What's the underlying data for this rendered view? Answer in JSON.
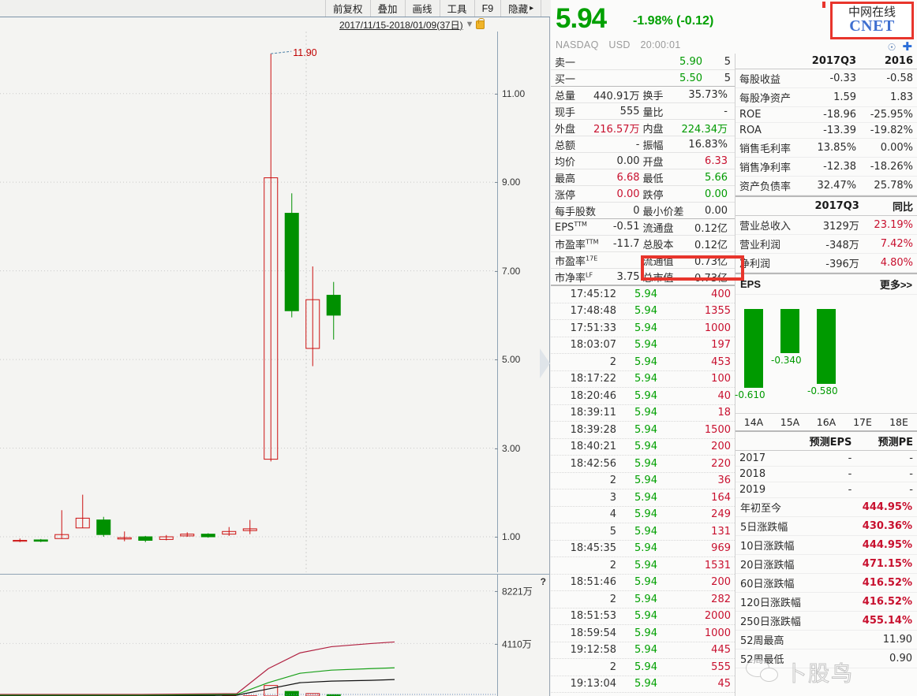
{
  "toolbar": {
    "buttons": [
      "前复权",
      "叠加",
      "画线",
      "工具",
      "F9",
      "隐藏"
    ],
    "date_range": "2017/11/15-2018/01/09(37日)"
  },
  "quote": {
    "last_price": "5.94",
    "change": "-1.98% (-0.12)",
    "exchange": "NASDAQ",
    "currency": "USD",
    "time": "20:00:01",
    "logo_cn": "中网在线",
    "logo_en": "CNET"
  },
  "level1": [
    {
      "k": "卖一",
      "v": "5.90",
      "v2": "5",
      "vclass": "green"
    },
    {
      "k": "买一",
      "v": "5.50",
      "v2": "5",
      "vclass": "green"
    }
  ],
  "stats": [
    [
      {
        "k": "总量",
        "v": "440.91万",
        "c": "dark"
      },
      {
        "k": "换手",
        "v": "35.73%",
        "c": "dark"
      }
    ],
    [
      {
        "k": "现手",
        "v": "555",
        "c": "dark"
      },
      {
        "k": "量比",
        "v": "-",
        "c": "dark"
      }
    ],
    [
      {
        "k": "外盘",
        "v": "216.57万",
        "c": "red"
      },
      {
        "k": "内盘",
        "v": "224.34万",
        "c": "green"
      }
    ],
    [
      {
        "k": "总额",
        "v": "-",
        "c": "dark"
      },
      {
        "k": "振幅",
        "v": "16.83%",
        "c": "dark"
      }
    ],
    [
      {
        "k": "均价",
        "v": "0.00",
        "c": "dark"
      },
      {
        "k": "开盘",
        "v": "6.33",
        "c": "red"
      }
    ],
    [
      {
        "k": "最高",
        "v": "6.68",
        "c": "red"
      },
      {
        "k": "最低",
        "v": "5.66",
        "c": "green"
      }
    ],
    [
      {
        "k": "涨停",
        "v": "0.00",
        "c": "red"
      },
      {
        "k": "跌停",
        "v": "0.00",
        "c": "green"
      }
    ],
    [
      {
        "k": "每手股数",
        "v": "0",
        "c": "dark"
      },
      {
        "k": "最小价差",
        "v": "0.00",
        "c": "dark"
      }
    ]
  ],
  "valuation": [
    [
      {
        "k": "EPS",
        "sup": "TTM",
        "v": "-0.51"
      },
      {
        "k": "流通盘",
        "sup": "",
        "v": "0.12亿"
      }
    ],
    [
      {
        "k": "市盈率",
        "sup": "TTM",
        "v": "-11.7"
      },
      {
        "k": "总股本",
        "sup": "",
        "v": "0.12亿"
      }
    ],
    [
      {
        "k": "市盈率",
        "sup": "17E",
        "v": ""
      },
      {
        "k": "流通值",
        "sup": "",
        "v": "0.73亿"
      }
    ],
    [
      {
        "k": "市净率",
        "sup": "LF",
        "v": "3.75"
      },
      {
        "k": "总市值",
        "sup": "",
        "v": "0.73亿"
      }
    ]
  ],
  "trades": [
    {
      "t": "17:45:12",
      "p": "5.94",
      "q": "400"
    },
    {
      "t": "17:48:48",
      "p": "5.94",
      "q": "1355"
    },
    {
      "t": "17:51:33",
      "p": "5.94",
      "q": "1000"
    },
    {
      "t": "18:03:07",
      "p": "5.94",
      "q": "197"
    },
    {
      "t": "2",
      "p": "5.94",
      "q": "453"
    },
    {
      "t": "18:17:22",
      "p": "5.94",
      "q": "100"
    },
    {
      "t": "18:20:46",
      "p": "5.94",
      "q": "40"
    },
    {
      "t": "18:39:11",
      "p": "5.94",
      "q": "18"
    },
    {
      "t": "18:39:28",
      "p": "5.94",
      "q": "1500"
    },
    {
      "t": "18:40:21",
      "p": "5.94",
      "q": "200"
    },
    {
      "t": "18:42:56",
      "p": "5.94",
      "q": "220"
    },
    {
      "t": "2",
      "p": "5.94",
      "q": "36"
    },
    {
      "t": "3",
      "p": "5.94",
      "q": "164"
    },
    {
      "t": "4",
      "p": "5.94",
      "q": "249"
    },
    {
      "t": "5",
      "p": "5.94",
      "q": "131"
    },
    {
      "t": "18:45:35",
      "p": "5.94",
      "q": "969"
    },
    {
      "t": "2",
      "p": "5.94",
      "q": "1531"
    },
    {
      "t": "18:51:46",
      "p": "5.94",
      "q": "200"
    },
    {
      "t": "2",
      "p": "5.94",
      "q": "282"
    },
    {
      "t": "18:51:53",
      "p": "5.94",
      "q": "2000"
    },
    {
      "t": "18:59:54",
      "p": "5.94",
      "q": "1000"
    },
    {
      "t": "19:12:58",
      "p": "5.94",
      "q": "445"
    },
    {
      "t": "2",
      "p": "5.94",
      "q": "555"
    },
    {
      "t": "19:13:04",
      "p": "5.94",
      "q": "45"
    }
  ],
  "fin_ratios": {
    "headers": [
      "",
      "2017Q3",
      "2016"
    ],
    "rows": [
      {
        "label": "每股收益",
        "c1": "-0.33",
        "c2": "-0.58"
      },
      {
        "label": "每股净资产",
        "c1": "1.59",
        "c2": "1.83"
      },
      {
        "label": "ROE",
        "c1": "-18.96",
        "c2": "-25.95%"
      },
      {
        "label": "ROA",
        "c1": "-13.39",
        "c2": "-19.82%"
      },
      {
        "label": "销售毛利率",
        "c1": "13.85%",
        "c2": "0.00%"
      },
      {
        "label": "销售净利率",
        "c1": "-12.38",
        "c2": "-18.26%"
      },
      {
        "label": "资产负债率",
        "c1": "32.47%",
        "c2": "25.78%"
      }
    ]
  },
  "fin_income": {
    "headers": [
      "",
      "2017Q3",
      "同比"
    ],
    "rows": [
      {
        "label": "营业总收入",
        "c1": "3129万",
        "c2": "23.19%"
      },
      {
        "label": "营业利润",
        "c1": "-348万",
        "c2": "7.42%"
      },
      {
        "label": "净利润",
        "c1": "-396万",
        "c2": "4.80%"
      }
    ]
  },
  "eps_section": {
    "title": "EPS",
    "more": "更多>>"
  },
  "forecast": {
    "headers": [
      "",
      "预测EPS",
      "预测PE"
    ],
    "rows": [
      {
        "year": "2017",
        "eps": "-",
        "pe": "-"
      },
      {
        "year": "2018",
        "eps": "-",
        "pe": "-"
      },
      {
        "year": "2019",
        "eps": "-",
        "pe": "-"
      }
    ]
  },
  "performance": [
    {
      "k": "年初至今",
      "v": "444.95%",
      "plain": false
    },
    {
      "k": "5日涨跌幅",
      "v": "430.36%",
      "plain": false
    },
    {
      "k": "10日涨跌幅",
      "v": "444.95%",
      "plain": false
    },
    {
      "k": "20日涨跌幅",
      "v": "471.15%",
      "plain": false
    },
    {
      "k": "60日涨跌幅",
      "v": "416.52%",
      "plain": false
    },
    {
      "k": "120日涨跌幅",
      "v": "416.52%",
      "plain": false
    },
    {
      "k": "250日涨跌幅",
      "v": "455.14%",
      "plain": false
    },
    {
      "k": "52周最高",
      "v": "11.90",
      "plain": true
    },
    {
      "k": "52周最低",
      "v": "0.90",
      "plain": true
    }
  ],
  "watermark": "卜股鸟",
  "chart_data": {
    "type": "candlestick",
    "title": "",
    "date_range": "2017/11/15-2018/01/09(37日)",
    "price_axis": {
      "ticks": [
        "11.00",
        "9.00",
        "7.00",
        "5.00",
        "3.00",
        "1.00"
      ],
      "values": [
        11,
        9,
        7,
        5,
        3,
        1
      ],
      "ylim": [
        0.2,
        12.4
      ]
    },
    "annotations": [
      {
        "text": "11.90",
        "value": 11.9,
        "color": "#c00000"
      }
    ],
    "volume_axis": {
      "ticks": [
        "8221万",
        "4110万"
      ],
      "values": [
        82210000,
        41100000
      ],
      "ylim": [
        0,
        9500000
      ]
    },
    "candles": [
      {
        "o": 0.92,
        "h": 0.96,
        "l": 0.88,
        "c": 0.9,
        "up": false,
        "vol": 60000
      },
      {
        "o": 0.9,
        "h": 0.95,
        "l": 0.88,
        "c": 0.93,
        "up": true,
        "vol": 70000
      },
      {
        "o": 1.05,
        "h": 1.6,
        "l": 0.96,
        "c": 0.96,
        "up": false,
        "vol": 120000
      },
      {
        "o": 1.42,
        "h": 1.95,
        "l": 1.2,
        "c": 1.2,
        "up": false,
        "vol": 150000
      },
      {
        "o": 1.05,
        "h": 1.45,
        "l": 1.0,
        "c": 1.38,
        "up": true,
        "vol": 260000
      },
      {
        "o": 0.98,
        "h": 1.12,
        "l": 0.9,
        "c": 0.95,
        "up": false,
        "vol": 90000
      },
      {
        "o": 0.92,
        "h": 1.02,
        "l": 0.88,
        "c": 1.0,
        "up": true,
        "vol": 110000
      },
      {
        "o": 1.0,
        "h": 1.04,
        "l": 0.92,
        "c": 0.94,
        "up": false,
        "vol": 80000
      },
      {
        "o": 1.06,
        "h": 1.1,
        "l": 1.0,
        "c": 1.02,
        "up": false,
        "vol": 95000
      },
      {
        "o": 1.0,
        "h": 1.08,
        "l": 0.98,
        "c": 1.06,
        "up": true,
        "vol": 100000
      },
      {
        "o": 1.12,
        "h": 1.22,
        "l": 1.02,
        "c": 1.06,
        "up": false,
        "vol": 130000
      },
      {
        "o": 1.18,
        "h": 1.38,
        "l": 1.06,
        "c": 1.14,
        "up": false,
        "vol": 160000
      },
      {
        "o": 9.1,
        "h": 11.9,
        "l": 2.7,
        "c": 2.75,
        "up": false,
        "vol": 8221000
      },
      {
        "o": 8.3,
        "h": 8.75,
        "l": 5.95,
        "c": 6.1,
        "up": true,
        "vol": 3600000
      },
      {
        "o": 6.35,
        "h": 7.1,
        "l": 4.85,
        "c": 5.25,
        "up": false,
        "vol": 1900000
      },
      {
        "o": 6.0,
        "h": 6.75,
        "l": 5.45,
        "c": 6.45,
        "up": true,
        "vol": 1100000
      }
    ],
    "volume_ma": [
      {
        "name": "MA-long",
        "color": "#b02040"
      },
      {
        "name": "MA-mid",
        "color": "#18a018"
      },
      {
        "name": "MA-short",
        "color": "#111111"
      }
    ],
    "eps_bar_chart": {
      "type": "bar",
      "categories": [
        "14A",
        "15A",
        "16A",
        "17E",
        "18E"
      ],
      "values": [
        -0.61,
        -0.34,
        -0.58,
        null,
        null
      ],
      "labels": [
        "-0.610",
        "-0.340",
        "-0.580",
        "",
        ""
      ],
      "color": "#009a00",
      "ylabel": "EPS"
    }
  }
}
